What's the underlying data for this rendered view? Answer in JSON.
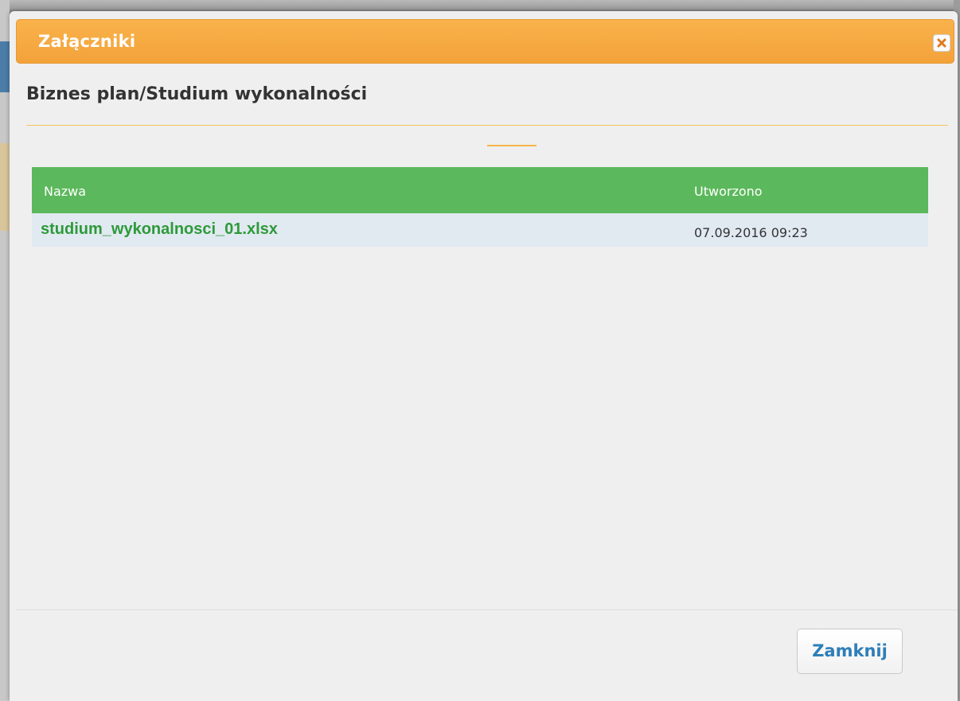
{
  "modal": {
    "title": "Załączniki",
    "close_icon": "close-icon",
    "subtitle": "Biznes plan/Studium wykonalności"
  },
  "table": {
    "columns": [
      "Nazwa",
      "Utworzono"
    ],
    "rows": [
      {
        "name": "studium_wykonalnosci_01.xlsx",
        "created": "07.09.2016 09:23"
      }
    ]
  },
  "footer": {
    "close_label": "Zamknij"
  },
  "colors": {
    "header_orange": "#f6a63f",
    "table_header_green": "#5cb85c",
    "link_green": "#2d9a38",
    "button_text_blue": "#2e7fb8",
    "row_background": "#e1e9f1"
  }
}
